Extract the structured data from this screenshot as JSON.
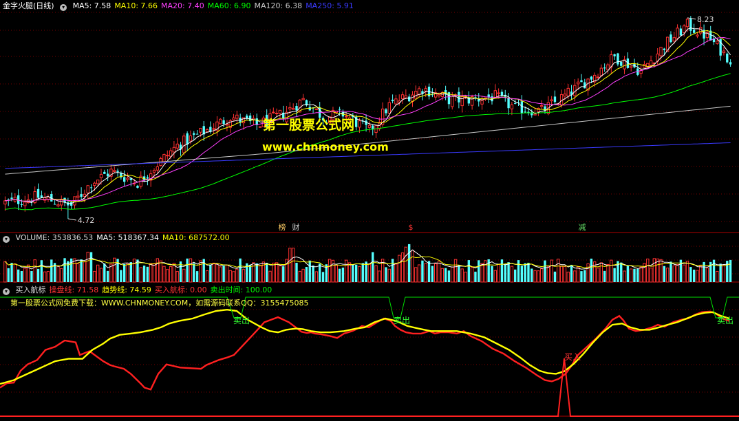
{
  "price_panel": {
    "title": "金字火腿(日线)",
    "legend": [
      {
        "label": "MA5: 7.58",
        "color": "#ffffff"
      },
      {
        "label": "MA10: 7.66",
        "color": "#ffff00"
      },
      {
        "label": "MA20: 7.40",
        "color": "#ff40ff"
      },
      {
        "label": "MA60: 6.90",
        "color": "#00ff00"
      },
      {
        "label": "MA120: 6.38",
        "color": "#c8c8c8"
      },
      {
        "label": "MA250: 5.91",
        "color": "#3a3aff"
      }
    ],
    "high_label": "8.23",
    "low_label": "4.72",
    "event_marks": [
      {
        "text": "榜",
        "x": 410,
        "color": "#ffcc66"
      },
      {
        "text": "财",
        "x": 430,
        "color": "#cccccc"
      },
      {
        "text": "$",
        "x": 597,
        "color": "#ff3333"
      },
      {
        "text": "减",
        "x": 846,
        "color": "#66dd66"
      }
    ]
  },
  "volume_panel": {
    "legend": [
      {
        "label": "VOLUME: 353836.53",
        "color": "#dddddd"
      },
      {
        "label": "MA5: 518367.34",
        "color": "#ffffff"
      },
      {
        "label": "MA10: 687572.00",
        "color": "#ffff00"
      }
    ]
  },
  "indicator_panel": {
    "legend": [
      {
        "label": "买入航标",
        "color": "#dddddd"
      },
      {
        "label": "操盘线: 71.58",
        "color": "#ff3333"
      },
      {
        "label": "趋势线: 74.59",
        "color": "#ffff00"
      },
      {
        "label": "买入航标: 0.00",
        "color": "#ff3333"
      },
      {
        "label": "卖出时间: 100.00",
        "color": "#00ff00"
      }
    ],
    "note": "第一股票公式网免费下载：WWW.CHNMONEY.COM，如需源码联系QQ：3155475085",
    "sell_label": "卖出",
    "buy_label": "买入"
  },
  "watermark": {
    "line1": "第一股票公式网",
    "line2": "www.chnmoney.com"
  },
  "colors": {
    "up": "#ff3232",
    "down": "#54ffff",
    "ma5": "#ffffff",
    "ma10": "#ffff00",
    "ma20": "#ff40ff",
    "ma60": "#00ff00",
    "ma120": "#c8c8c8",
    "ma250": "#3a3aff",
    "grid": "#7a0000"
  },
  "chart_data": [
    {
      "type": "candlestick",
      "price_range": [
        4.6,
        8.3
      ],
      "anchors": {
        "high": 8.23,
        "low": 4.72
      },
      "trend_points": [
        [
          0,
          5.0
        ],
        [
          10,
          5.1
        ],
        [
          20,
          4.95
        ],
        [
          26,
          5.35
        ],
        [
          32,
          5.55
        ],
        [
          40,
          5.35
        ],
        [
          52,
          6.0
        ],
        [
          62,
          6.3
        ],
        [
          68,
          6.5
        ],
        [
          76,
          6.35
        ],
        [
          84,
          6.55
        ],
        [
          90,
          6.8
        ],
        [
          96,
          6.5
        ],
        [
          102,
          6.55
        ],
        [
          110,
          6.25
        ],
        [
          116,
          6.7
        ],
        [
          126,
          7.0
        ],
        [
          134,
          6.8
        ],
        [
          140,
          6.8
        ],
        [
          148,
          6.85
        ],
        [
          154,
          6.65
        ],
        [
          162,
          6.6
        ],
        [
          170,
          6.9
        ],
        [
          176,
          7.15
        ],
        [
          184,
          7.55
        ],
        [
          192,
          7.3
        ],
        [
          200,
          7.8
        ],
        [
          206,
          8.1
        ],
        [
          212,
          7.9
        ],
        [
          219,
          7.5
        ]
      ],
      "ma_values": {
        "MA5": 7.58,
        "MA10": 7.66,
        "MA20": 7.4,
        "MA60": 6.9,
        "MA120": 6.38,
        "MA250": 5.91
      }
    },
    {
      "type": "bar",
      "series": [
        {
          "name": "VOLUME",
          "value": 353836.53
        },
        {
          "name": "MA5",
          "value": 518367.34
        },
        {
          "name": "MA10",
          "value": 687572.0
        }
      ]
    },
    {
      "type": "line",
      "y_range": [
        0,
        100
      ],
      "red_points": [
        [
          0,
          18
        ],
        [
          10,
          25
        ],
        [
          20,
          26
        ],
        [
          30,
          45
        ],
        [
          40,
          55
        ],
        [
          54,
          62
        ],
        [
          66,
          78
        ],
        [
          80,
          83
        ],
        [
          94,
          93
        ],
        [
          100,
          92
        ],
        [
          110,
          90
        ],
        [
          116,
          70
        ],
        [
          130,
          76
        ],
        [
          150,
          60
        ],
        [
          160,
          54
        ],
        [
          166,
          52
        ],
        [
          180,
          48
        ],
        [
          190,
          40
        ],
        [
          204,
          25
        ],
        [
          210,
          18
        ],
        [
          219,
          15
        ],
        [
          230,
          40
        ],
        [
          242,
          55
        ],
        [
          262,
          50
        ],
        [
          292,
          48
        ],
        [
          300,
          54
        ],
        [
          318,
          62
        ],
        [
          330,
          66
        ],
        [
          340,
          70
        ],
        [
          352,
          84
        ],
        [
          364,
          98
        ],
        [
          376,
          112
        ],
        [
          384,
          122
        ],
        [
          394,
          126
        ],
        [
          404,
          130
        ],
        [
          412,
          126
        ],
        [
          420,
          122
        ],
        [
          432,
          112
        ],
        [
          438,
          107
        ],
        [
          446,
          105
        ],
        [
          452,
          106
        ],
        [
          458,
          104
        ],
        [
          466,
          103
        ],
        [
          480,
          100
        ],
        [
          490,
          97
        ],
        [
          500,
          104
        ],
        [
          512,
          108
        ],
        [
          520,
          112
        ],
        [
          526,
          116
        ],
        [
          536,
          114
        ],
        [
          548,
          122
        ],
        [
          558,
          128
        ],
        [
          568,
          124
        ],
        [
          574,
          116
        ],
        [
          582,
          110
        ],
        [
          590,
          106
        ],
        [
          600,
          104
        ],
        [
          612,
          104
        ],
        [
          624,
          108
        ],
        [
          632,
          104
        ],
        [
          640,
          106
        ],
        [
          652,
          106
        ],
        [
          664,
          104
        ],
        [
          674,
          108
        ],
        [
          684,
          100
        ],
        [
          700,
          92
        ],
        [
          716,
          80
        ],
        [
          732,
          72
        ],
        [
          748,
          60
        ],
        [
          764,
          50
        ],
        [
          780,
          38
        ],
        [
          792,
          30
        ],
        [
          802,
          28
        ],
        [
          812,
          32
        ],
        [
          822,
          40
        ],
        [
          830,
          52
        ],
        [
          840,
          70
        ],
        [
          850,
          80
        ],
        [
          866,
          96
        ],
        [
          880,
          112
        ],
        [
          890,
          126
        ],
        [
          900,
          132
        ],
        [
          906,
          125
        ],
        [
          914,
          112
        ],
        [
          924,
          108
        ],
        [
          936,
          110
        ],
        [
          948,
          114
        ],
        [
          956,
          118
        ],
        [
          966,
          115
        ],
        [
          978,
          122
        ],
        [
          990,
          126
        ],
        [
          1000,
          128
        ],
        [
          1010,
          134
        ],
        [
          1020,
          138
        ],
        [
          1032,
          139
        ],
        [
          1040,
          136
        ],
        [
          1050,
          128
        ],
        [
          1060,
          124
        ]
      ],
      "yellow_points": [
        [
          0,
          24
        ],
        [
          20,
          30
        ],
        [
          40,
          40
        ],
        [
          56,
          48
        ],
        [
          70,
          55
        ],
        [
          80,
          60
        ],
        [
          100,
          64
        ],
        [
          120,
          64
        ],
        [
          134,
          78
        ],
        [
          150,
          88
        ],
        [
          160,
          96
        ],
        [
          174,
          102
        ],
        [
          190,
          104
        ],
        [
          204,
          106
        ],
        [
          222,
          110
        ],
        [
          234,
          114
        ],
        [
          246,
          120
        ],
        [
          260,
          124
        ],
        [
          280,
          128
        ],
        [
          296,
          134
        ],
        [
          314,
          140
        ],
        [
          330,
          142
        ],
        [
          344,
          140
        ],
        [
          360,
          126
        ],
        [
          370,
          120
        ],
        [
          380,
          114
        ],
        [
          392,
          108
        ],
        [
          404,
          106
        ],
        [
          416,
          110
        ],
        [
          430,
          112
        ],
        [
          440,
          111
        ],
        [
          452,
          108
        ],
        [
          466,
          106
        ],
        [
          480,
          106
        ],
        [
          500,
          108
        ],
        [
          518,
          112
        ],
        [
          530,
          114
        ],
        [
          544,
          122
        ],
        [
          560,
          128
        ],
        [
          576,
          124
        ],
        [
          592,
          116
        ],
        [
          608,
          112
        ],
        [
          626,
          108
        ],
        [
          644,
          108
        ],
        [
          664,
          108
        ],
        [
          684,
          104
        ],
        [
          704,
          98
        ],
        [
          722,
          88
        ],
        [
          740,
          78
        ],
        [
          756,
          66
        ],
        [
          770,
          54
        ],
        [
          784,
          45
        ],
        [
          796,
          41
        ],
        [
          808,
          40
        ],
        [
          820,
          44
        ],
        [
          834,
          56
        ],
        [
          848,
          72
        ],
        [
          862,
          90
        ],
        [
          876,
          106
        ],
        [
          890,
          118
        ],
        [
          904,
          120
        ],
        [
          916,
          114
        ],
        [
          930,
          110
        ],
        [
          944,
          110
        ],
        [
          958,
          114
        ],
        [
          970,
          118
        ],
        [
          984,
          122
        ],
        [
          998,
          128
        ],
        [
          1012,
          134
        ],
        [
          1024,
          137
        ],
        [
          1036,
          138
        ],
        [
          1048,
          132
        ],
        [
          1060,
          128
        ]
      ]
    }
  ]
}
